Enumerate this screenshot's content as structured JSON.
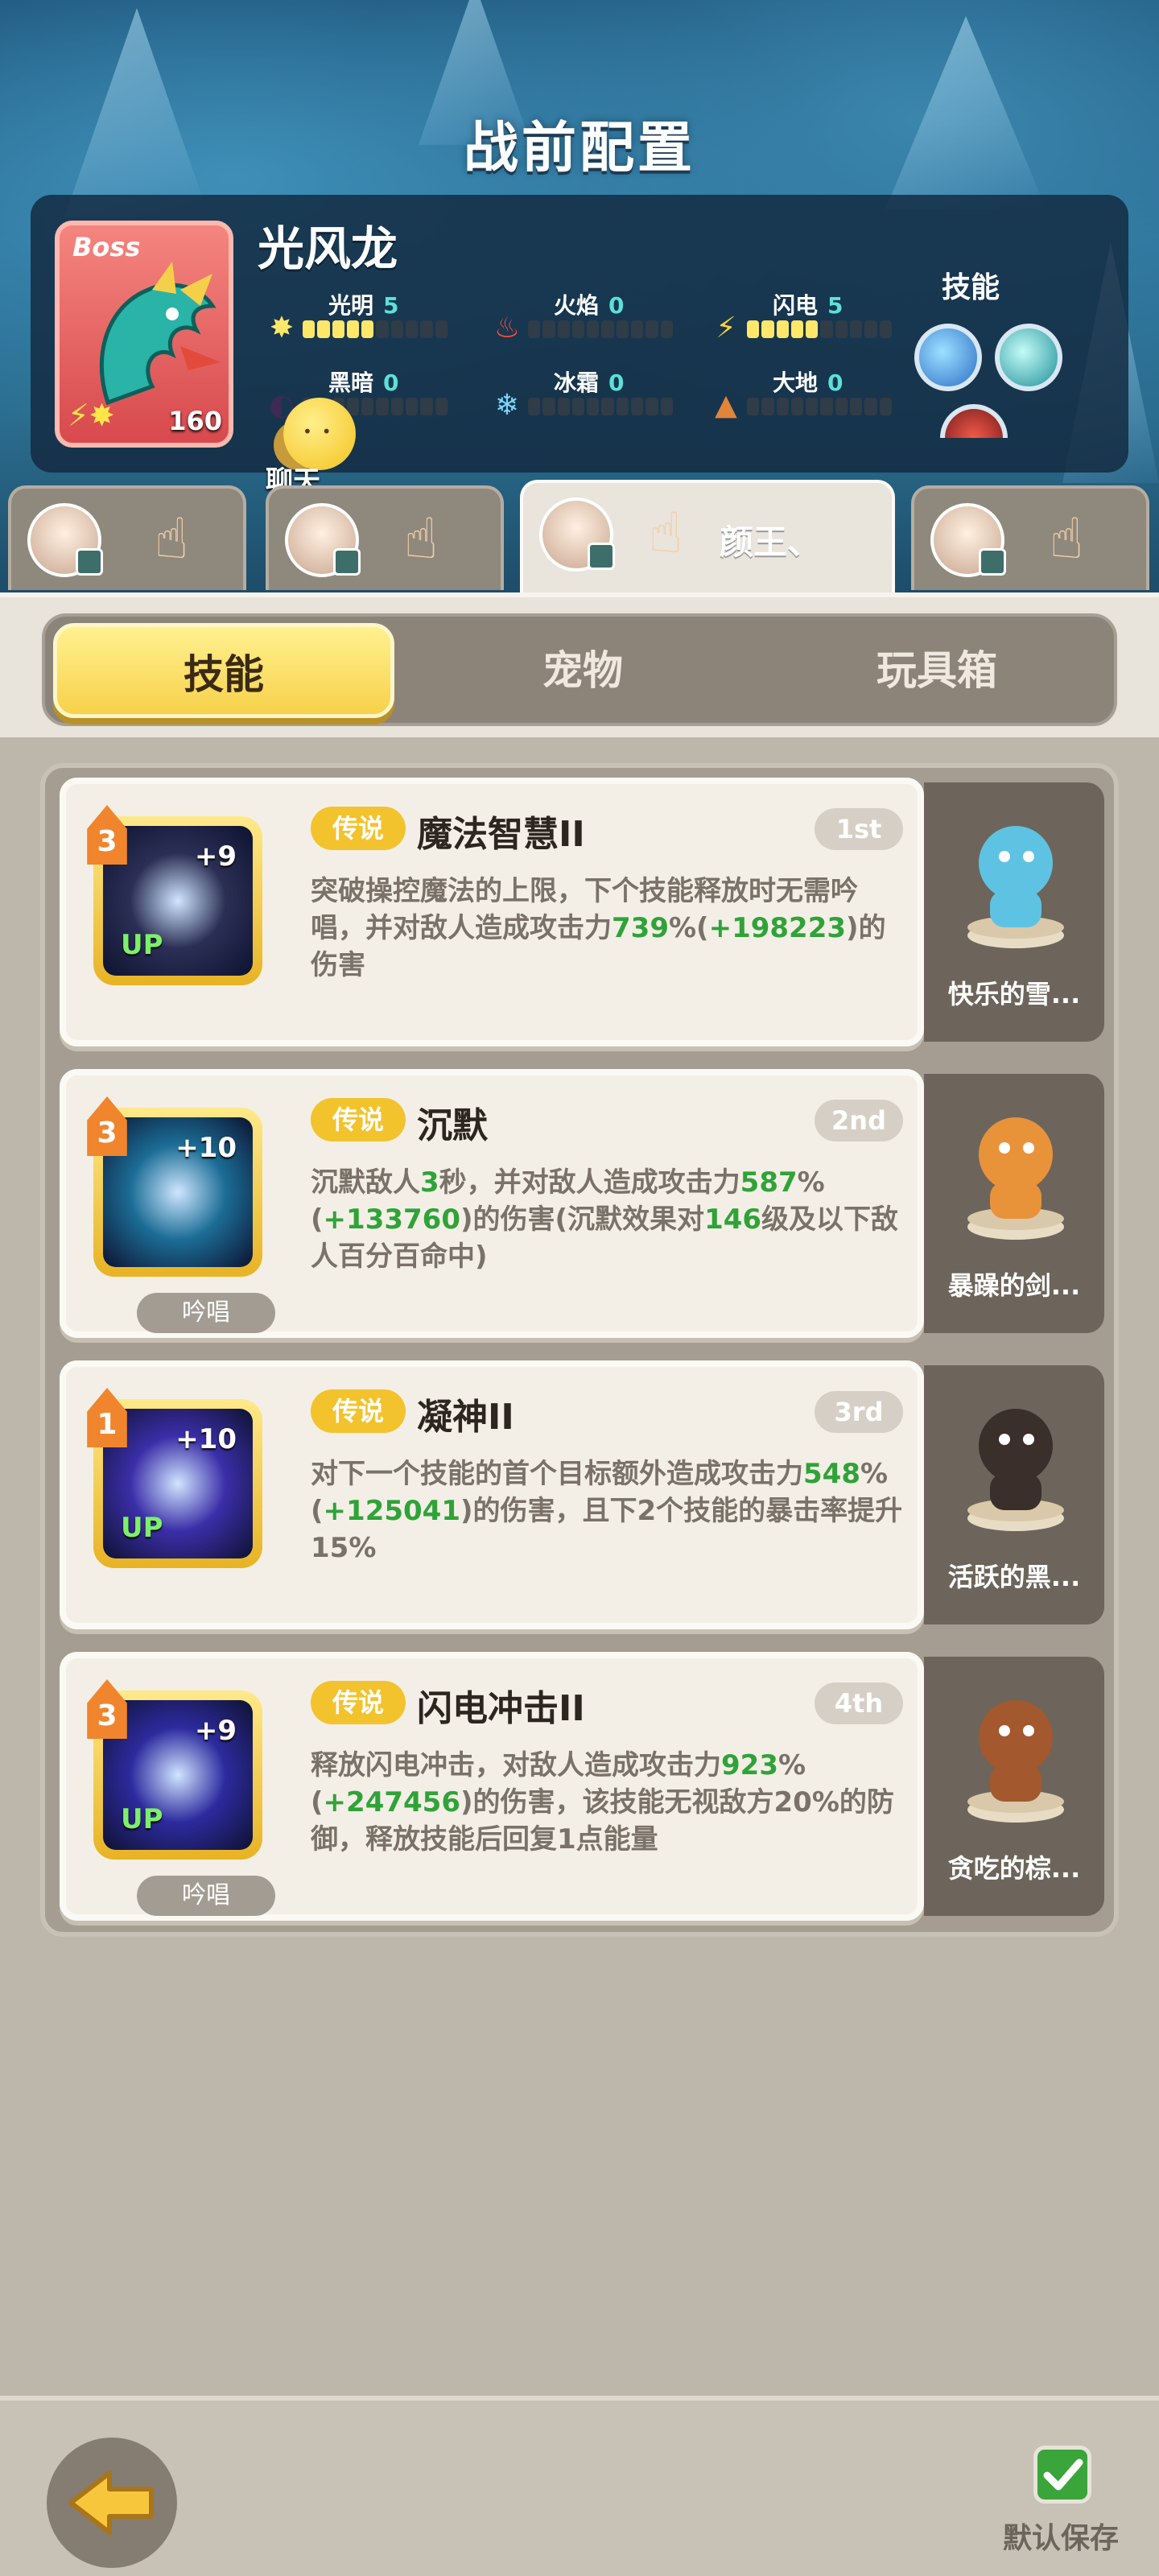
{
  "page": {
    "title": "战前配置"
  },
  "boss": {
    "tag": "Boss",
    "name": "光风龙",
    "level": "160",
    "skill_label": "技能",
    "stats": [
      {
        "name": "光明",
        "value": "5",
        "icon": "sun-icon",
        "filled": 5,
        "color": "#ffe76a"
      },
      {
        "name": "火焰",
        "value": "0",
        "icon": "fire-icon",
        "filled": 0,
        "color": "#ff4b3a"
      },
      {
        "name": "闪电",
        "value": "5",
        "icon": "lightning-icon",
        "filled": 5,
        "color": "#ffd23a"
      },
      {
        "name": "黑暗",
        "value": "0",
        "icon": "dark-icon",
        "filled": 0,
        "color": "#3d2a57"
      },
      {
        "name": "冰霜",
        "value": "0",
        "icon": "snowflake-icon",
        "filled": 0,
        "color": "#7fd6ff"
      },
      {
        "name": "大地",
        "value": "0",
        "icon": "earth-icon",
        "filled": 0,
        "color": "#e0863a"
      }
    ]
  },
  "chat": {
    "label": "聊天"
  },
  "team_tabs": [
    {
      "label": ""
    },
    {
      "label": ""
    },
    {
      "label": "颜王、"
    },
    {
      "label": ""
    }
  ],
  "tabs": [
    {
      "label": "技能",
      "active": true
    },
    {
      "label": "宠物",
      "active": false
    },
    {
      "label": "玩具箱",
      "active": false
    }
  ],
  "skills": [
    {
      "rarity": "传说",
      "name": "魔法智慧II",
      "order": "1st",
      "level": "3",
      "plus": "+9",
      "up": "UP",
      "chant": "",
      "desc_parts": [
        "突破操控魔法的上限，下个技能释放时无需吟唱，并对敌人造成攻击力",
        "739",
        "%(",
        "+198223",
        ")的伤害"
      ],
      "pet_name": "快乐的雪...",
      "icon_color": "#2b2f55",
      "icon": "magic-wisdom-icon"
    },
    {
      "rarity": "传说",
      "name": "沉默",
      "order": "2nd",
      "level": "3",
      "plus": "+10",
      "up": "",
      "chant": "吟唱",
      "desc_parts": [
        "沉默敌人",
        "3",
        "秒，并对敌人造成攻击力",
        "587",
        "%(",
        "+133760",
        ")的伤害(沉默效果对",
        "146",
        "级及以下敌人百分百命中)"
      ],
      "pet_name": "暴躁的剑...",
      "icon_color": "#1b6d96",
      "icon": "silence-icon"
    },
    {
      "rarity": "传说",
      "name": "凝神II",
      "order": "3rd",
      "level": "1",
      "plus": "+10",
      "up": "UP",
      "chant": "",
      "desc_parts": [
        "对下一个技能的首个目标额外造成攻击力",
        "548",
        "%(",
        "+125041",
        ")的伤害，且下2个技能的暴击率提升15%"
      ],
      "pet_name": "活跃的黑...",
      "icon_color": "#3b2ea8",
      "icon": "focus-eye-icon"
    },
    {
      "rarity": "传说",
      "name": "闪电冲击II",
      "order": "4th",
      "level": "3",
      "plus": "+9",
      "up": "UP",
      "chant": "吟唱",
      "desc_parts": [
        "释放闪电冲击，对敌人造成攻击力",
        "923",
        "%(",
        "+247456",
        ")的伤害，该技能无视敌方20%的防御，释放技能后回复1点能量"
      ],
      "pet_name": "贪吃的棕...",
      "icon_color": "#2d2a9e",
      "icon": "lightning-strike-icon"
    }
  ],
  "bottom": {
    "save_label": "默认保存"
  }
}
